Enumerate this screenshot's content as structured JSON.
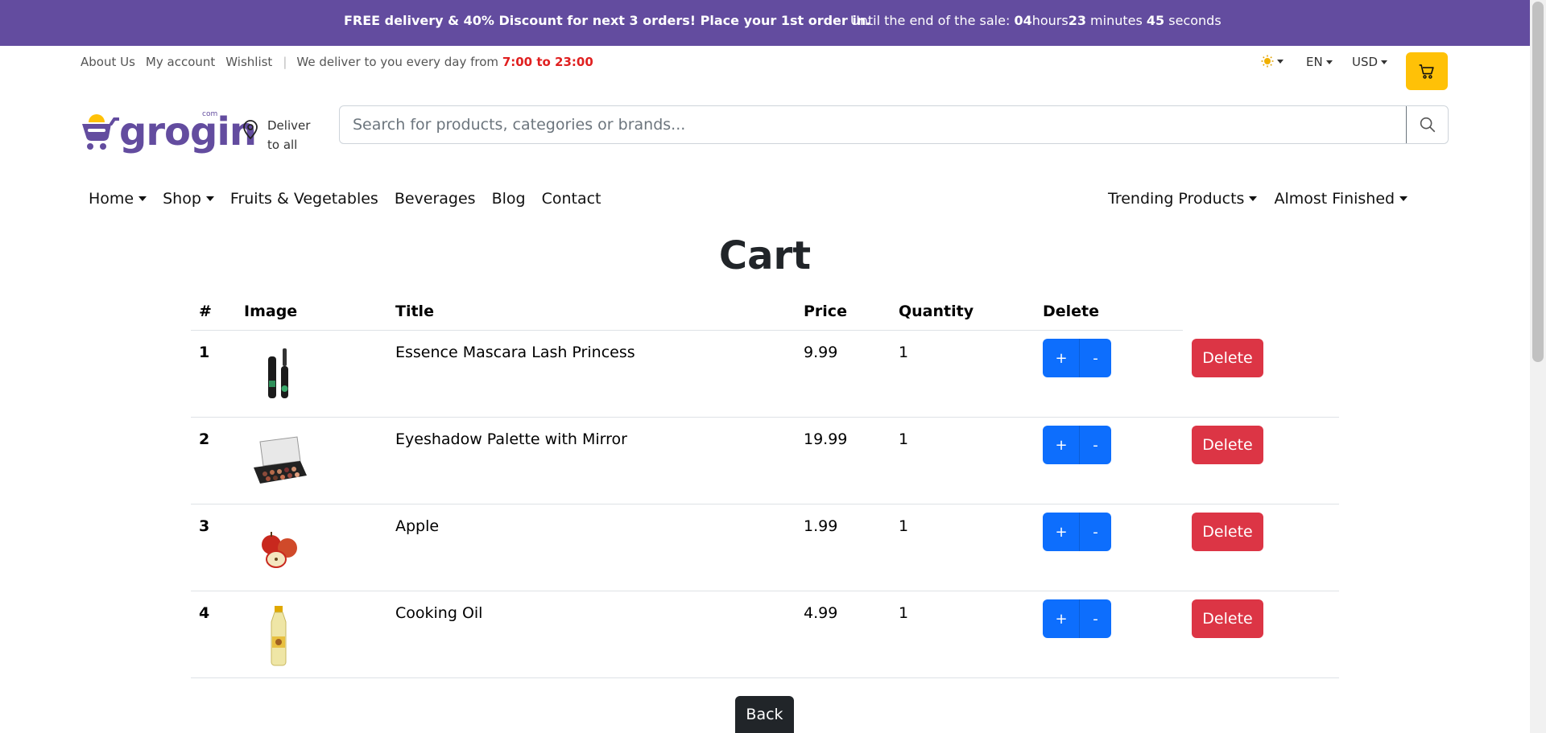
{
  "promo": {
    "left_text": "FREE delivery & 40% Discount for next 3 orders! Place your 1st order in.",
    "sale_prefix": "Until the end of the sale:",
    "hours_value": "04",
    "hours_label": "hours",
    "minutes_value": "23",
    "minutes_label": "minutes",
    "seconds_value": "45",
    "seconds_label": "seconds"
  },
  "topbar": {
    "links": [
      "About Us",
      "My account",
      "Wishlist"
    ],
    "separator": "|",
    "delivery_text": "We deliver to you every day from",
    "delivery_hours": "7:00 to 23:00",
    "language": "EN",
    "currency": "USD"
  },
  "header": {
    "logo_text": "grogin",
    "logo_suffix": "com",
    "deliver_line1": "Deliver",
    "deliver_line2": "to all",
    "search_placeholder": "Search for products, categories or brands..."
  },
  "nav": {
    "left": [
      "Home",
      "Shop",
      "Fruits & Vegetables",
      "Beverages",
      "Blog",
      "Contact"
    ],
    "right": [
      "Trending Products",
      "Almost Finished"
    ]
  },
  "page_title": "Cart",
  "table": {
    "headers": [
      "#",
      "Image",
      "Title",
      "Price",
      "Quantity",
      "Delete"
    ],
    "rows": [
      {
        "num": "1",
        "title": "Essence Mascara Lash Princess",
        "price": "9.99",
        "qty": "1",
        "image": "mascara"
      },
      {
        "num": "2",
        "title": "Eyeshadow Palette with Mirror",
        "price": "19.99",
        "qty": "1",
        "image": "eyeshadow-palette"
      },
      {
        "num": "3",
        "title": "Apple",
        "price": "1.99",
        "qty": "1",
        "image": "apple"
      },
      {
        "num": "4",
        "title": "Cooking Oil",
        "price": "4.99",
        "qty": "1",
        "image": "cooking-oil"
      }
    ],
    "plus_label": "+",
    "minus_label": "-",
    "delete_label": "Delete"
  },
  "back_label": "Back",
  "colors": {
    "brand_purple": "#634c9f",
    "cart_yellow": "#ffc107",
    "primary_blue": "#0d6efd",
    "danger_red": "#dc3545",
    "hours_red": "#e02020"
  }
}
